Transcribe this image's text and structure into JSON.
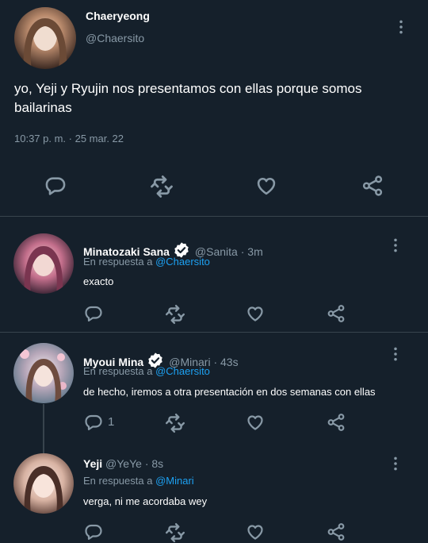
{
  "main_tweet": {
    "name": "Chaeryeong",
    "handle": "@Chaersito",
    "text": "yo, Yeji y Ryujin nos presentamos con ellas porque somos bailarinas",
    "timestamp": "10:37 p. m. · 25 mar. 22",
    "avatar_icon": "avatar-photo",
    "actions": [
      "reply-icon",
      "retweet-icon",
      "like-icon",
      "share-icon"
    ]
  },
  "replies": [
    {
      "name": "Minatozaki Sana",
      "verified": true,
      "handle": "@Sanita",
      "time": "· 3m",
      "in_reply_prefix": "En respuesta a",
      "in_reply_to": "@Chaersito",
      "text": "exacto",
      "reply_count": ""
    },
    {
      "name": "Myoui Mina",
      "verified": true,
      "handle": "@Minari",
      "time": "· 43s",
      "in_reply_prefix": "En respuesta a",
      "in_reply_to": "@Chaersito",
      "text": "de hecho, iremos a otra presentación en dos semanas con ellas",
      "reply_count": "1"
    },
    {
      "name": "Yeji",
      "verified": false,
      "handle": "@YeYe",
      "time": "· 8s",
      "in_reply_prefix": "En respuesta a",
      "in_reply_to": "@Minari",
      "text": "verga, ni me acordaba wey",
      "reply_count": ""
    }
  ],
  "colors": {
    "background": "#15202b",
    "divider": "#38444d",
    "secondary_text": "#8899a6",
    "link": "#1da1f2",
    "verified_badge": "#ffffff"
  }
}
